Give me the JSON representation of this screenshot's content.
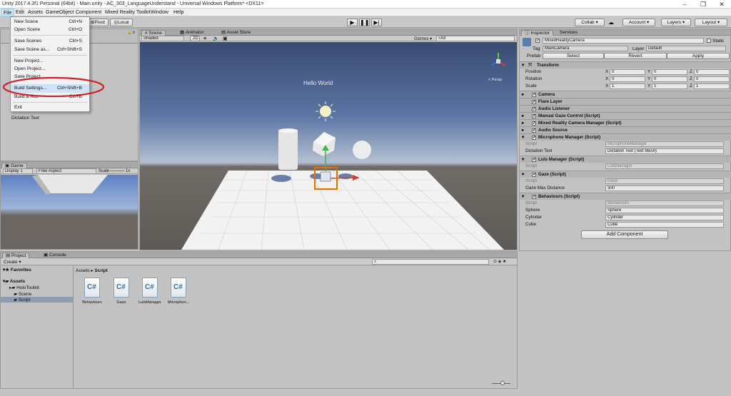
{
  "window": {
    "title": "Unity 2017.4.3f1 Personal (64bit) - Main.unity - AC_303_LanguageUnderstand - Universal Windows Platform* <DX11>"
  },
  "menu": [
    "File",
    "Edit",
    "Assets",
    "GameObject",
    "Component",
    "Mixed Reality Toolkit",
    "Window",
    "Help"
  ],
  "file_menu": [
    {
      "label": "New Scene",
      "shortcut": "Ctrl+N"
    },
    {
      "label": "Open Scene",
      "shortcut": "Ctrl+O"
    },
    {
      "label": "Save Scenes",
      "shortcut": "Ctrl+S"
    },
    {
      "label": "Save Scene as...",
      "shortcut": "Ctrl+Shift+S"
    },
    {
      "label": "New Project...",
      "shortcut": ""
    },
    {
      "label": "Open Project...",
      "shortcut": ""
    },
    {
      "label": "Save Project",
      "shortcut": ""
    },
    {
      "label": "Build Settings...",
      "shortcut": "Ctrl+Shift+B"
    },
    {
      "label": "Build & Run",
      "shortcut": "Ctrl+B"
    },
    {
      "label": "Exit",
      "shortcut": ""
    }
  ],
  "toolbar": {
    "pivot": "Pivot",
    "local": "Local",
    "collab": "Collab ▾",
    "account": "Account ▾",
    "layers": "Layers ▾",
    "layout": "Layout ▾"
  },
  "hierarchy": {
    "last_item": "Dictation Text"
  },
  "game": {
    "tab": "Game",
    "display": "Display 1",
    "aspect": "Free Aspect",
    "scale_label": "Scale",
    "scale": "1x"
  },
  "scene": {
    "tabs": [
      "Scene",
      "Animator",
      "Asset Store"
    ],
    "shading": "Shaded",
    "mode_2d": "2D",
    "gizmos": "Gizmos ▾",
    "search": "All",
    "hello_text": "Hello World",
    "persp": "< Persp"
  },
  "inspector": {
    "tabs": [
      "Inspector",
      "Services"
    ],
    "object_name": "MixedRealityCamera",
    "static_label": "Static",
    "tag_label": "Tag",
    "tag": "MainCamera",
    "layer_label": "Layer",
    "layer": "Default",
    "prefab_label": "Prefab",
    "prefab_buttons": [
      "Select",
      "Revert",
      "Apply"
    ],
    "transform": {
      "title": "Transform",
      "rows": [
        {
          "label": "Position",
          "x": "0",
          "y": "0",
          "z": "0"
        },
        {
          "label": "Rotation",
          "x": "0",
          "y": "0",
          "z": "0"
        },
        {
          "label": "Scale",
          "x": "1",
          "y": "1",
          "z": "1"
        }
      ],
      "axis": [
        "X",
        "Y",
        "Z"
      ]
    },
    "components": [
      "Camera",
      "Flare Layer",
      "Audio Listener",
      "Manual Gaze Control (Script)",
      "Mixed Reality Camera Manager (Script)",
      "Audio Source",
      "Microphone Manager (Script)"
    ],
    "script_label": "Script",
    "microphone": {
      "script": "MicrophoneManager",
      "field_label": "Dictation Text",
      "field_value": "Dictation Text (Text Mesh)"
    },
    "luis": {
      "title": "Luis Manager (Script)",
      "script": "LuisManager"
    },
    "gaze": {
      "title": "Gaze (Script)",
      "script": "Gaze",
      "field_label": "Gaze Max Distance",
      "field_value": "300"
    },
    "behaviours": {
      "title": "Behaviours (Script)",
      "script": "Behaviours",
      "fields": [
        {
          "label": "Sphere",
          "value": "Sphere"
        },
        {
          "label": "Cylinder",
          "value": "Cylinder"
        },
        {
          "label": "Cube",
          "value": "Cube"
        }
      ]
    },
    "add_component": "Add Component"
  },
  "project": {
    "tabs": [
      "Project",
      "Console"
    ],
    "create": "Create ▾",
    "favorites": "Favorites",
    "assets_root": "Assets",
    "tree": [
      "HoloToolkit",
      "Scene",
      "Script"
    ],
    "breadcrumb": [
      "Assets",
      "Script"
    ],
    "files": [
      "Behaviours",
      "Gaze",
      "LuisManager",
      "Microphon..."
    ]
  },
  "colors": {
    "highlight_ring": "#d0202a",
    "selection_box": "#e07000",
    "menu_highlight": "#cfe3f7"
  }
}
